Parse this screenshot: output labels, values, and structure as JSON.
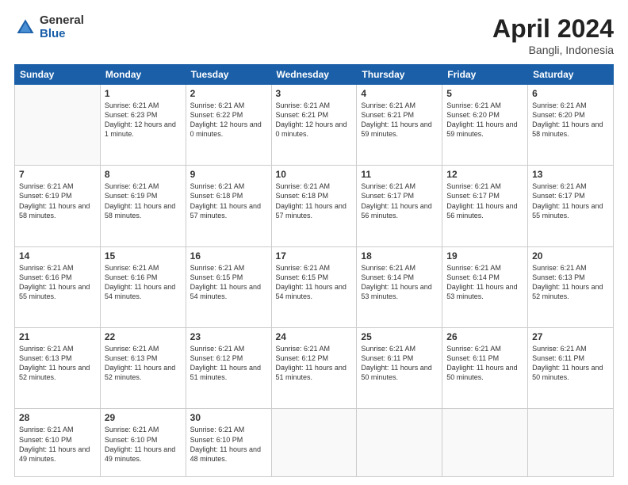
{
  "logo": {
    "general": "General",
    "blue": "Blue"
  },
  "header": {
    "month": "April 2024",
    "location": "Bangli, Indonesia"
  },
  "weekdays": [
    "Sunday",
    "Monday",
    "Tuesday",
    "Wednesday",
    "Thursday",
    "Friday",
    "Saturday"
  ],
  "weeks": [
    [
      null,
      {
        "day": "1",
        "sunrise": "6:21 AM",
        "sunset": "6:23 PM",
        "daylight": "12 hours and 1 minute."
      },
      {
        "day": "2",
        "sunrise": "6:21 AM",
        "sunset": "6:22 PM",
        "daylight": "12 hours and 0 minutes."
      },
      {
        "day": "3",
        "sunrise": "6:21 AM",
        "sunset": "6:21 PM",
        "daylight": "12 hours and 0 minutes."
      },
      {
        "day": "4",
        "sunrise": "6:21 AM",
        "sunset": "6:21 PM",
        "daylight": "11 hours and 59 minutes."
      },
      {
        "day": "5",
        "sunrise": "6:21 AM",
        "sunset": "6:20 PM",
        "daylight": "11 hours and 59 minutes."
      },
      {
        "day": "6",
        "sunrise": "6:21 AM",
        "sunset": "6:20 PM",
        "daylight": "11 hours and 58 minutes."
      }
    ],
    [
      {
        "day": "7",
        "sunrise": "6:21 AM",
        "sunset": "6:19 PM",
        "daylight": "11 hours and 58 minutes."
      },
      {
        "day": "8",
        "sunrise": "6:21 AM",
        "sunset": "6:19 PM",
        "daylight": "11 hours and 58 minutes."
      },
      {
        "day": "9",
        "sunrise": "6:21 AM",
        "sunset": "6:18 PM",
        "daylight": "11 hours and 57 minutes."
      },
      {
        "day": "10",
        "sunrise": "6:21 AM",
        "sunset": "6:18 PM",
        "daylight": "11 hours and 57 minutes."
      },
      {
        "day": "11",
        "sunrise": "6:21 AM",
        "sunset": "6:17 PM",
        "daylight": "11 hours and 56 minutes."
      },
      {
        "day": "12",
        "sunrise": "6:21 AM",
        "sunset": "6:17 PM",
        "daylight": "11 hours and 56 minutes."
      },
      {
        "day": "13",
        "sunrise": "6:21 AM",
        "sunset": "6:17 PM",
        "daylight": "11 hours and 55 minutes."
      }
    ],
    [
      {
        "day": "14",
        "sunrise": "6:21 AM",
        "sunset": "6:16 PM",
        "daylight": "11 hours and 55 minutes."
      },
      {
        "day": "15",
        "sunrise": "6:21 AM",
        "sunset": "6:16 PM",
        "daylight": "11 hours and 54 minutes."
      },
      {
        "day": "16",
        "sunrise": "6:21 AM",
        "sunset": "6:15 PM",
        "daylight": "11 hours and 54 minutes."
      },
      {
        "day": "17",
        "sunrise": "6:21 AM",
        "sunset": "6:15 PM",
        "daylight": "11 hours and 54 minutes."
      },
      {
        "day": "18",
        "sunrise": "6:21 AM",
        "sunset": "6:14 PM",
        "daylight": "11 hours and 53 minutes."
      },
      {
        "day": "19",
        "sunrise": "6:21 AM",
        "sunset": "6:14 PM",
        "daylight": "11 hours and 53 minutes."
      },
      {
        "day": "20",
        "sunrise": "6:21 AM",
        "sunset": "6:13 PM",
        "daylight": "11 hours and 52 minutes."
      }
    ],
    [
      {
        "day": "21",
        "sunrise": "6:21 AM",
        "sunset": "6:13 PM",
        "daylight": "11 hours and 52 minutes."
      },
      {
        "day": "22",
        "sunrise": "6:21 AM",
        "sunset": "6:13 PM",
        "daylight": "11 hours and 52 minutes."
      },
      {
        "day": "23",
        "sunrise": "6:21 AM",
        "sunset": "6:12 PM",
        "daylight": "11 hours and 51 minutes."
      },
      {
        "day": "24",
        "sunrise": "6:21 AM",
        "sunset": "6:12 PM",
        "daylight": "11 hours and 51 minutes."
      },
      {
        "day": "25",
        "sunrise": "6:21 AM",
        "sunset": "6:11 PM",
        "daylight": "11 hours and 50 minutes."
      },
      {
        "day": "26",
        "sunrise": "6:21 AM",
        "sunset": "6:11 PM",
        "daylight": "11 hours and 50 minutes."
      },
      {
        "day": "27",
        "sunrise": "6:21 AM",
        "sunset": "6:11 PM",
        "daylight": "11 hours and 50 minutes."
      }
    ],
    [
      {
        "day": "28",
        "sunrise": "6:21 AM",
        "sunset": "6:10 PM",
        "daylight": "11 hours and 49 minutes."
      },
      {
        "day": "29",
        "sunrise": "6:21 AM",
        "sunset": "6:10 PM",
        "daylight": "11 hours and 49 minutes."
      },
      {
        "day": "30",
        "sunrise": "6:21 AM",
        "sunset": "6:10 PM",
        "daylight": "11 hours and 48 minutes."
      },
      null,
      null,
      null,
      null
    ]
  ]
}
